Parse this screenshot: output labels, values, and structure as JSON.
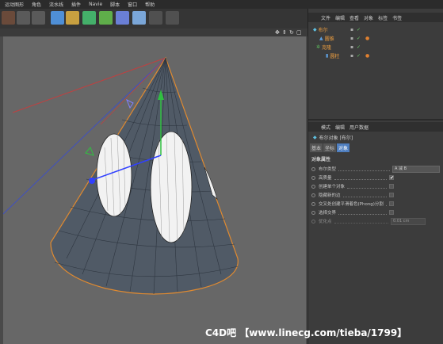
{
  "menubar": {
    "items": [
      "运动图形",
      "角色",
      "流水线",
      "插件",
      "Navie",
      "脚本",
      "窗口",
      "帮助"
    ]
  },
  "objects_panel": {
    "tabs": [
      "文件",
      "编辑",
      "查看",
      "对象",
      "标签",
      "书签"
    ],
    "tree": [
      {
        "name": "布尔",
        "indent": 0
      },
      {
        "name": "圆锥",
        "indent": 1
      },
      {
        "name": "克隆",
        "indent": 1
      },
      {
        "name": "圆柱",
        "indent": 2
      }
    ]
  },
  "attributes_panel": {
    "tabs": [
      "模式",
      "编辑",
      "用户数据"
    ],
    "object_title": "布尔对象 [布尔]",
    "subtabs": [
      "基本",
      "坐标",
      "对象"
    ],
    "active_subtab": "对象",
    "section": "对象属性",
    "rows": [
      {
        "label": "布尔类型",
        "value": "A 减 B",
        "kind": "select"
      },
      {
        "label": "高质量",
        "value": "✔",
        "kind": "check"
      },
      {
        "label": "创建单个对象",
        "value": "",
        "kind": "check"
      },
      {
        "label": "隐藏新的边",
        "value": "",
        "kind": "check"
      },
      {
        "label": "交叉处创建平滑着色(Phong)分割",
        "value": "",
        "kind": "check"
      },
      {
        "label": "选择交界",
        "value": "",
        "kind": "check"
      },
      {
        "label": "优化点",
        "value": "0.01 cm",
        "kind": "number"
      }
    ]
  },
  "viewport": {
    "icons": [
      "move-view-icon",
      "zoom-view-icon",
      "rotate-view-icon",
      "maximize-view-icon"
    ]
  },
  "watermark": "C4D吧 【www.linecg.com/tieba/1799】",
  "colors": {
    "accent": "#f0a040",
    "panel": "#3c3c3c",
    "viewport": "#676767"
  }
}
